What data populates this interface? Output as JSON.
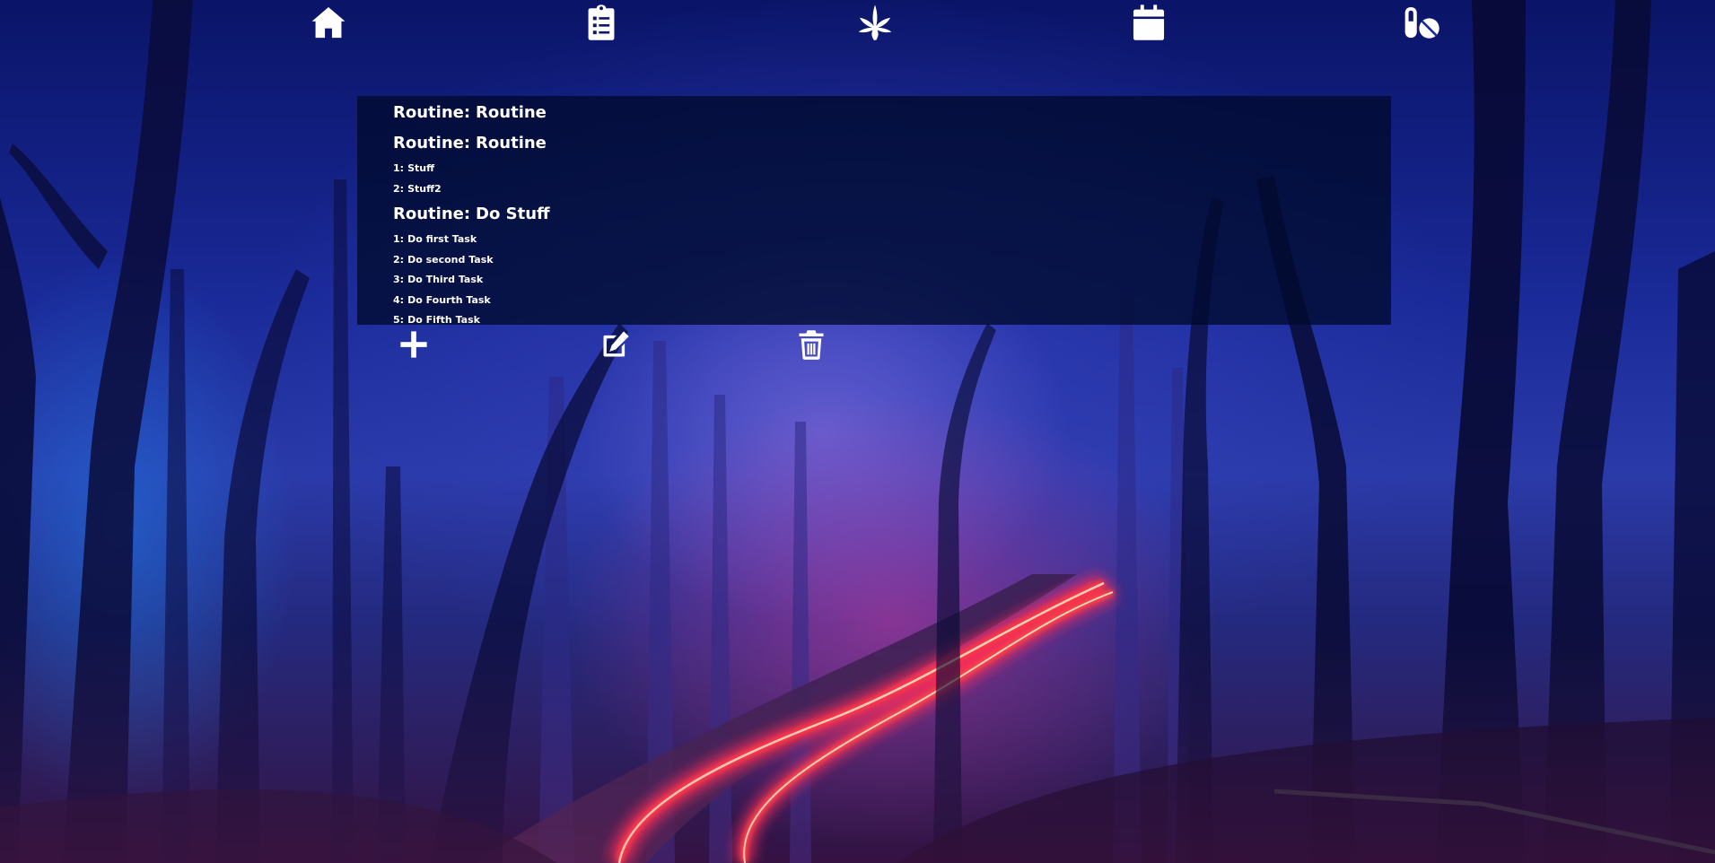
{
  "nav": {
    "items": [
      {
        "icon": "home-icon"
      },
      {
        "icon": "clipboard-list-icon"
      },
      {
        "icon": "cannabis-leaf-icon"
      },
      {
        "icon": "calendar-icon"
      },
      {
        "icon": "pills-icon"
      }
    ]
  },
  "routines": [
    {
      "prefix": "Routine:",
      "name": "Routine",
      "tasks": []
    },
    {
      "prefix": "Routine:",
      "name": "Routine",
      "tasks": [
        {
          "num": "1:",
          "text": "Stuff"
        },
        {
          "num": "2:",
          "text": "Stuff2"
        }
      ]
    },
    {
      "prefix": "Routine:",
      "name": "Do Stuff",
      "tasks": [
        {
          "num": "1:",
          "text": "Do first Task"
        },
        {
          "num": "2:",
          "text": "Do second Task"
        },
        {
          "num": "3:",
          "text": "Do Third Task"
        },
        {
          "num": "4:",
          "text": "Do Fourth Task"
        },
        {
          "num": "5:",
          "text": "Do Fifth Task"
        }
      ]
    }
  ],
  "actions": {
    "add": "plus-icon",
    "edit": "edit-icon",
    "delete": "trash-icon"
  },
  "colors": {
    "text": "#ffffff",
    "panel": "#000a2d",
    "light_trail": "#ff2a3c"
  }
}
